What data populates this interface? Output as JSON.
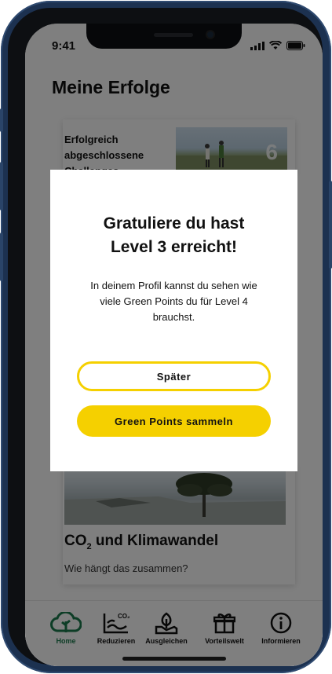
{
  "status_bar": {
    "time": "9:41"
  },
  "page": {
    "title": "Meine Erfolge"
  },
  "cards": {
    "challenges": {
      "text": "Erfolgreich abgeschlossene Challenges",
      "number": "6"
    },
    "article": {
      "title_main": "CO",
      "title_sub": "2",
      "title_rest": " und Klimawandel",
      "subtitle": "Wie hängt das zusammen?"
    }
  },
  "modal": {
    "title_line1": "Gratuliere du hast",
    "title_line2": "Level 3 erreicht!",
    "text": "In deinem Profil kannst du sehen wie viele Green Points du für Level 4 brauchst.",
    "later_label": "Später",
    "collect_label": "Green Points sammeln"
  },
  "tabs": [
    {
      "label": "Home",
      "icon": "cloud-tree-icon",
      "active": true
    },
    {
      "label": "Reduzieren",
      "icon": "co2-chart-icon",
      "active": false
    },
    {
      "label": "Ausgleichen",
      "icon": "plant-hand-icon",
      "active": false
    },
    {
      "label": "Vorteilswelt",
      "icon": "gift-icon",
      "active": false
    },
    {
      "label": "Informieren",
      "icon": "info-icon",
      "active": false
    }
  ],
  "colors": {
    "accent": "#f5d000",
    "active_tab": "#1a7a4c",
    "frame": "#1c3150"
  }
}
